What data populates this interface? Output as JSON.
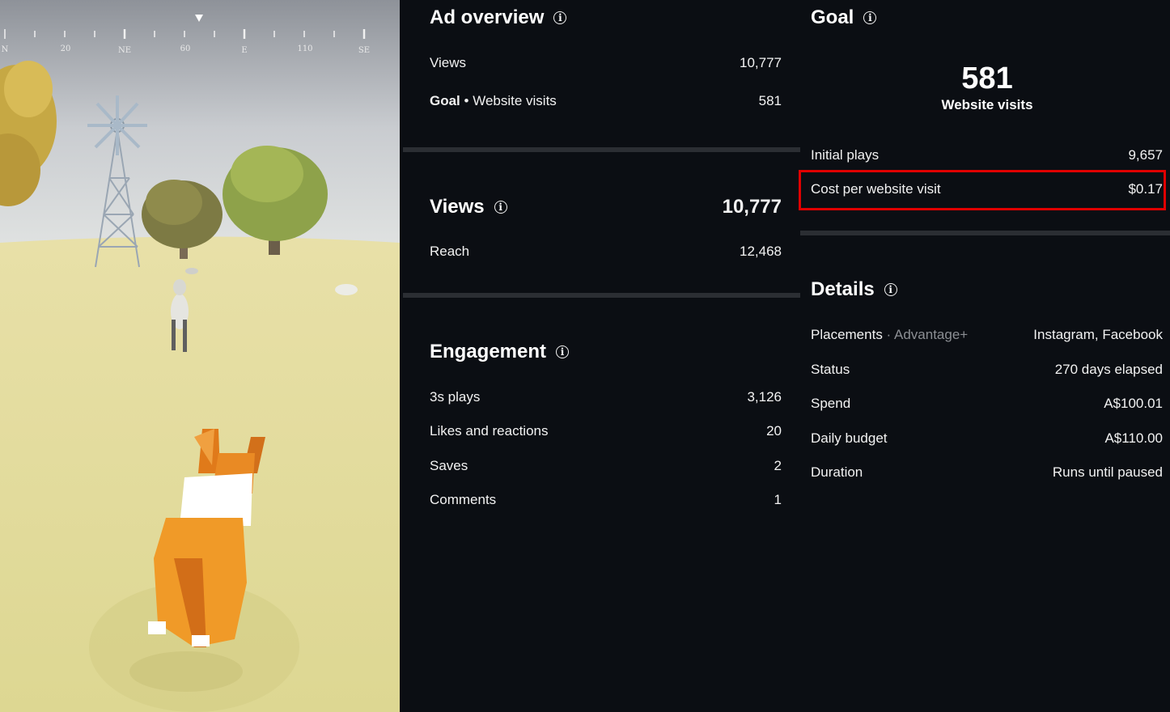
{
  "game": {
    "compass": {
      "labels": [
        "N",
        "20",
        "NE",
        "60",
        "E",
        "110",
        "SE"
      ]
    }
  },
  "ad_overview": {
    "title": "Ad overview",
    "views_label": "Views",
    "views_value": "10,777",
    "goal_label_bold": "Goal",
    "goal_label_rest": "Website visits",
    "goal_value": "581"
  },
  "views": {
    "title": "Views",
    "value": "10,777",
    "reach_label": "Reach",
    "reach_value": "12,468"
  },
  "engagement": {
    "title": "Engagement",
    "rows": [
      {
        "label": "3s plays",
        "value": "3,126"
      },
      {
        "label": "Likes and reactions",
        "value": "20"
      },
      {
        "label": "Saves",
        "value": "2"
      },
      {
        "label": "Comments",
        "value": "1"
      }
    ]
  },
  "goal": {
    "title": "Goal",
    "big_number": "581",
    "big_label": "Website visits",
    "initial_plays_label": "Initial plays",
    "initial_plays_value": "9,657",
    "cost_label": "Cost per website visit",
    "cost_value": "$0.17"
  },
  "details": {
    "title": "Details",
    "placements_label": "Placements",
    "placements_sub": "Advantage+",
    "placements_value": "Instagram, Facebook",
    "rows": [
      {
        "label": "Status",
        "value": "270 days elapsed"
      },
      {
        "label": "Spend",
        "value": "A$100.01"
      },
      {
        "label": "Daily budget",
        "value": "A$110.00"
      },
      {
        "label": "Duration",
        "value": "Runs until paused"
      }
    ]
  },
  "colors": {
    "background": "#0b0e13",
    "highlight": "#e00000",
    "divider": "#2b2e33"
  }
}
